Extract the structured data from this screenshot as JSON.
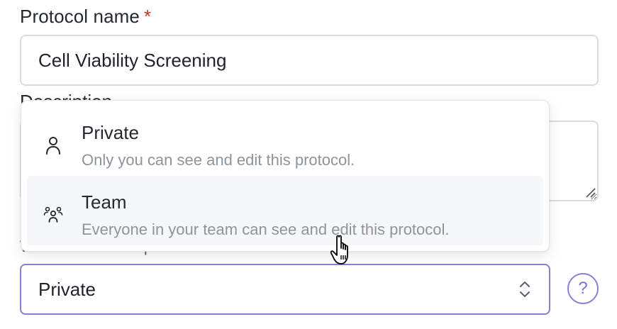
{
  "form": {
    "protocol_name_label": "Protocol name",
    "required_marker": "*",
    "protocol_name_value": "Cell Viability Screening",
    "description_label": "Description",
    "visibility_label": "Who can see this protocol",
    "visibility_selected": "Private",
    "help_label": "?"
  },
  "dropdown": {
    "options": [
      {
        "title": "Private",
        "description": "Only you can see and edit this protocol.",
        "icon": "person-icon"
      },
      {
        "title": "Team",
        "description": "Everyone in your team can see and edit this protocol.",
        "icon": "team-icon"
      }
    ]
  },
  "colors": {
    "accent": "#8a7fd8",
    "required": "#c0392b",
    "hover_bg": "#f5f7f9",
    "muted_text": "#8c949c"
  }
}
